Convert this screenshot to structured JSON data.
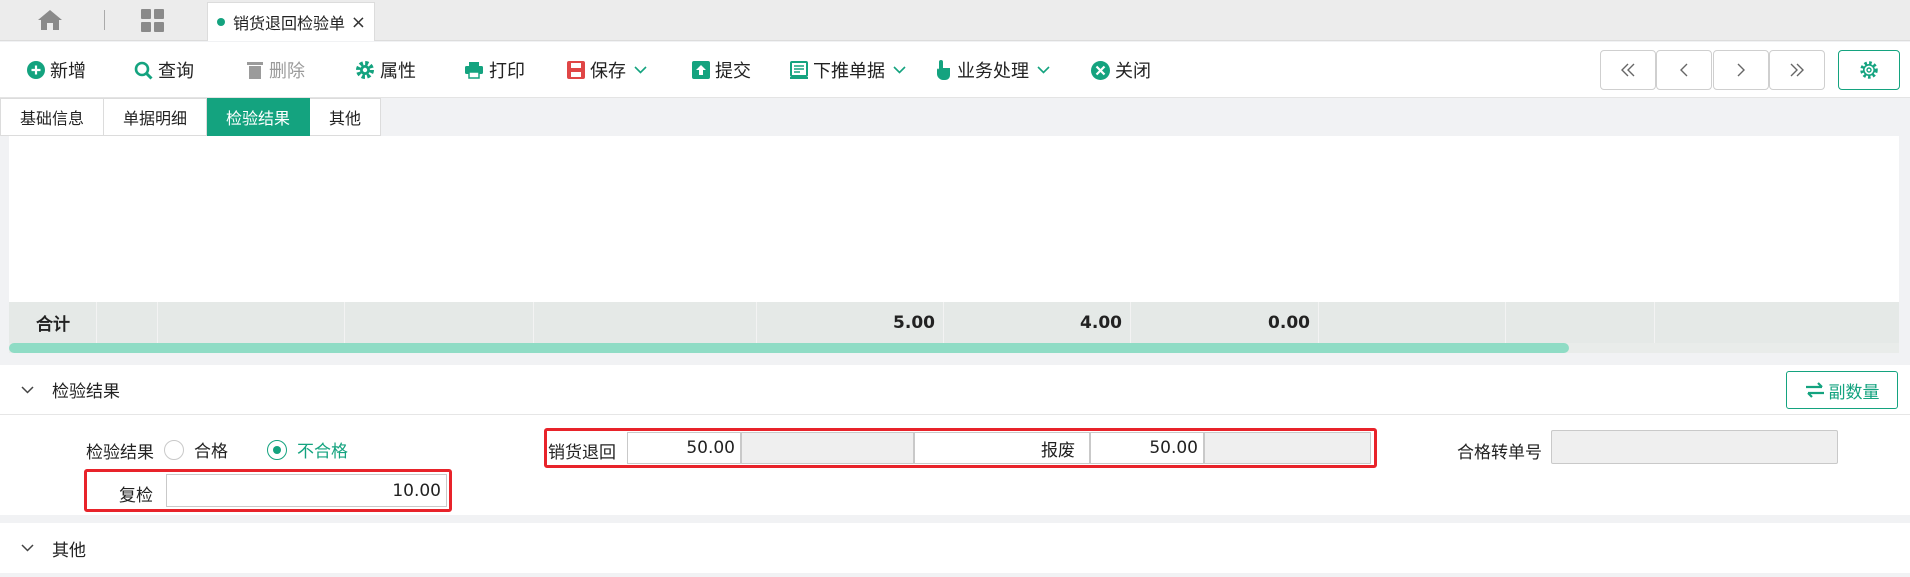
{
  "tabs": {
    "doc_tab_label": "销货退回检验单"
  },
  "toolbar": {
    "new": "新增",
    "query": "查询",
    "delete": "删除",
    "properties": "属性",
    "print": "打印",
    "save": "保存",
    "submit": "提交",
    "push_down": "下推单据",
    "business": "业务处理",
    "close": "关闭"
  },
  "subtabs": [
    "基础信息",
    "单据明细",
    "检验结果",
    "其他"
  ],
  "grid": {
    "total_label": "合计",
    "totals": [
      "5.00",
      "4.00",
      "0.00"
    ]
  },
  "result_section": {
    "title": "检验结果",
    "aux_button": "副数量",
    "result_label": "检验结果",
    "option_pass": "合格",
    "option_fail": "不合格",
    "selected": "不合格",
    "sales_return_label": "销货退回",
    "sales_return_value": "50.00",
    "scrap_label": "报废",
    "scrap_value": "50.00",
    "pass_transfer_label": "合格转单号",
    "pass_transfer_value": "",
    "recheck_label": "复检",
    "recheck_value": "10.00"
  },
  "other_section": {
    "title": "其他"
  },
  "colors": {
    "accent": "#14a37f",
    "highlight": "#e8232a"
  }
}
